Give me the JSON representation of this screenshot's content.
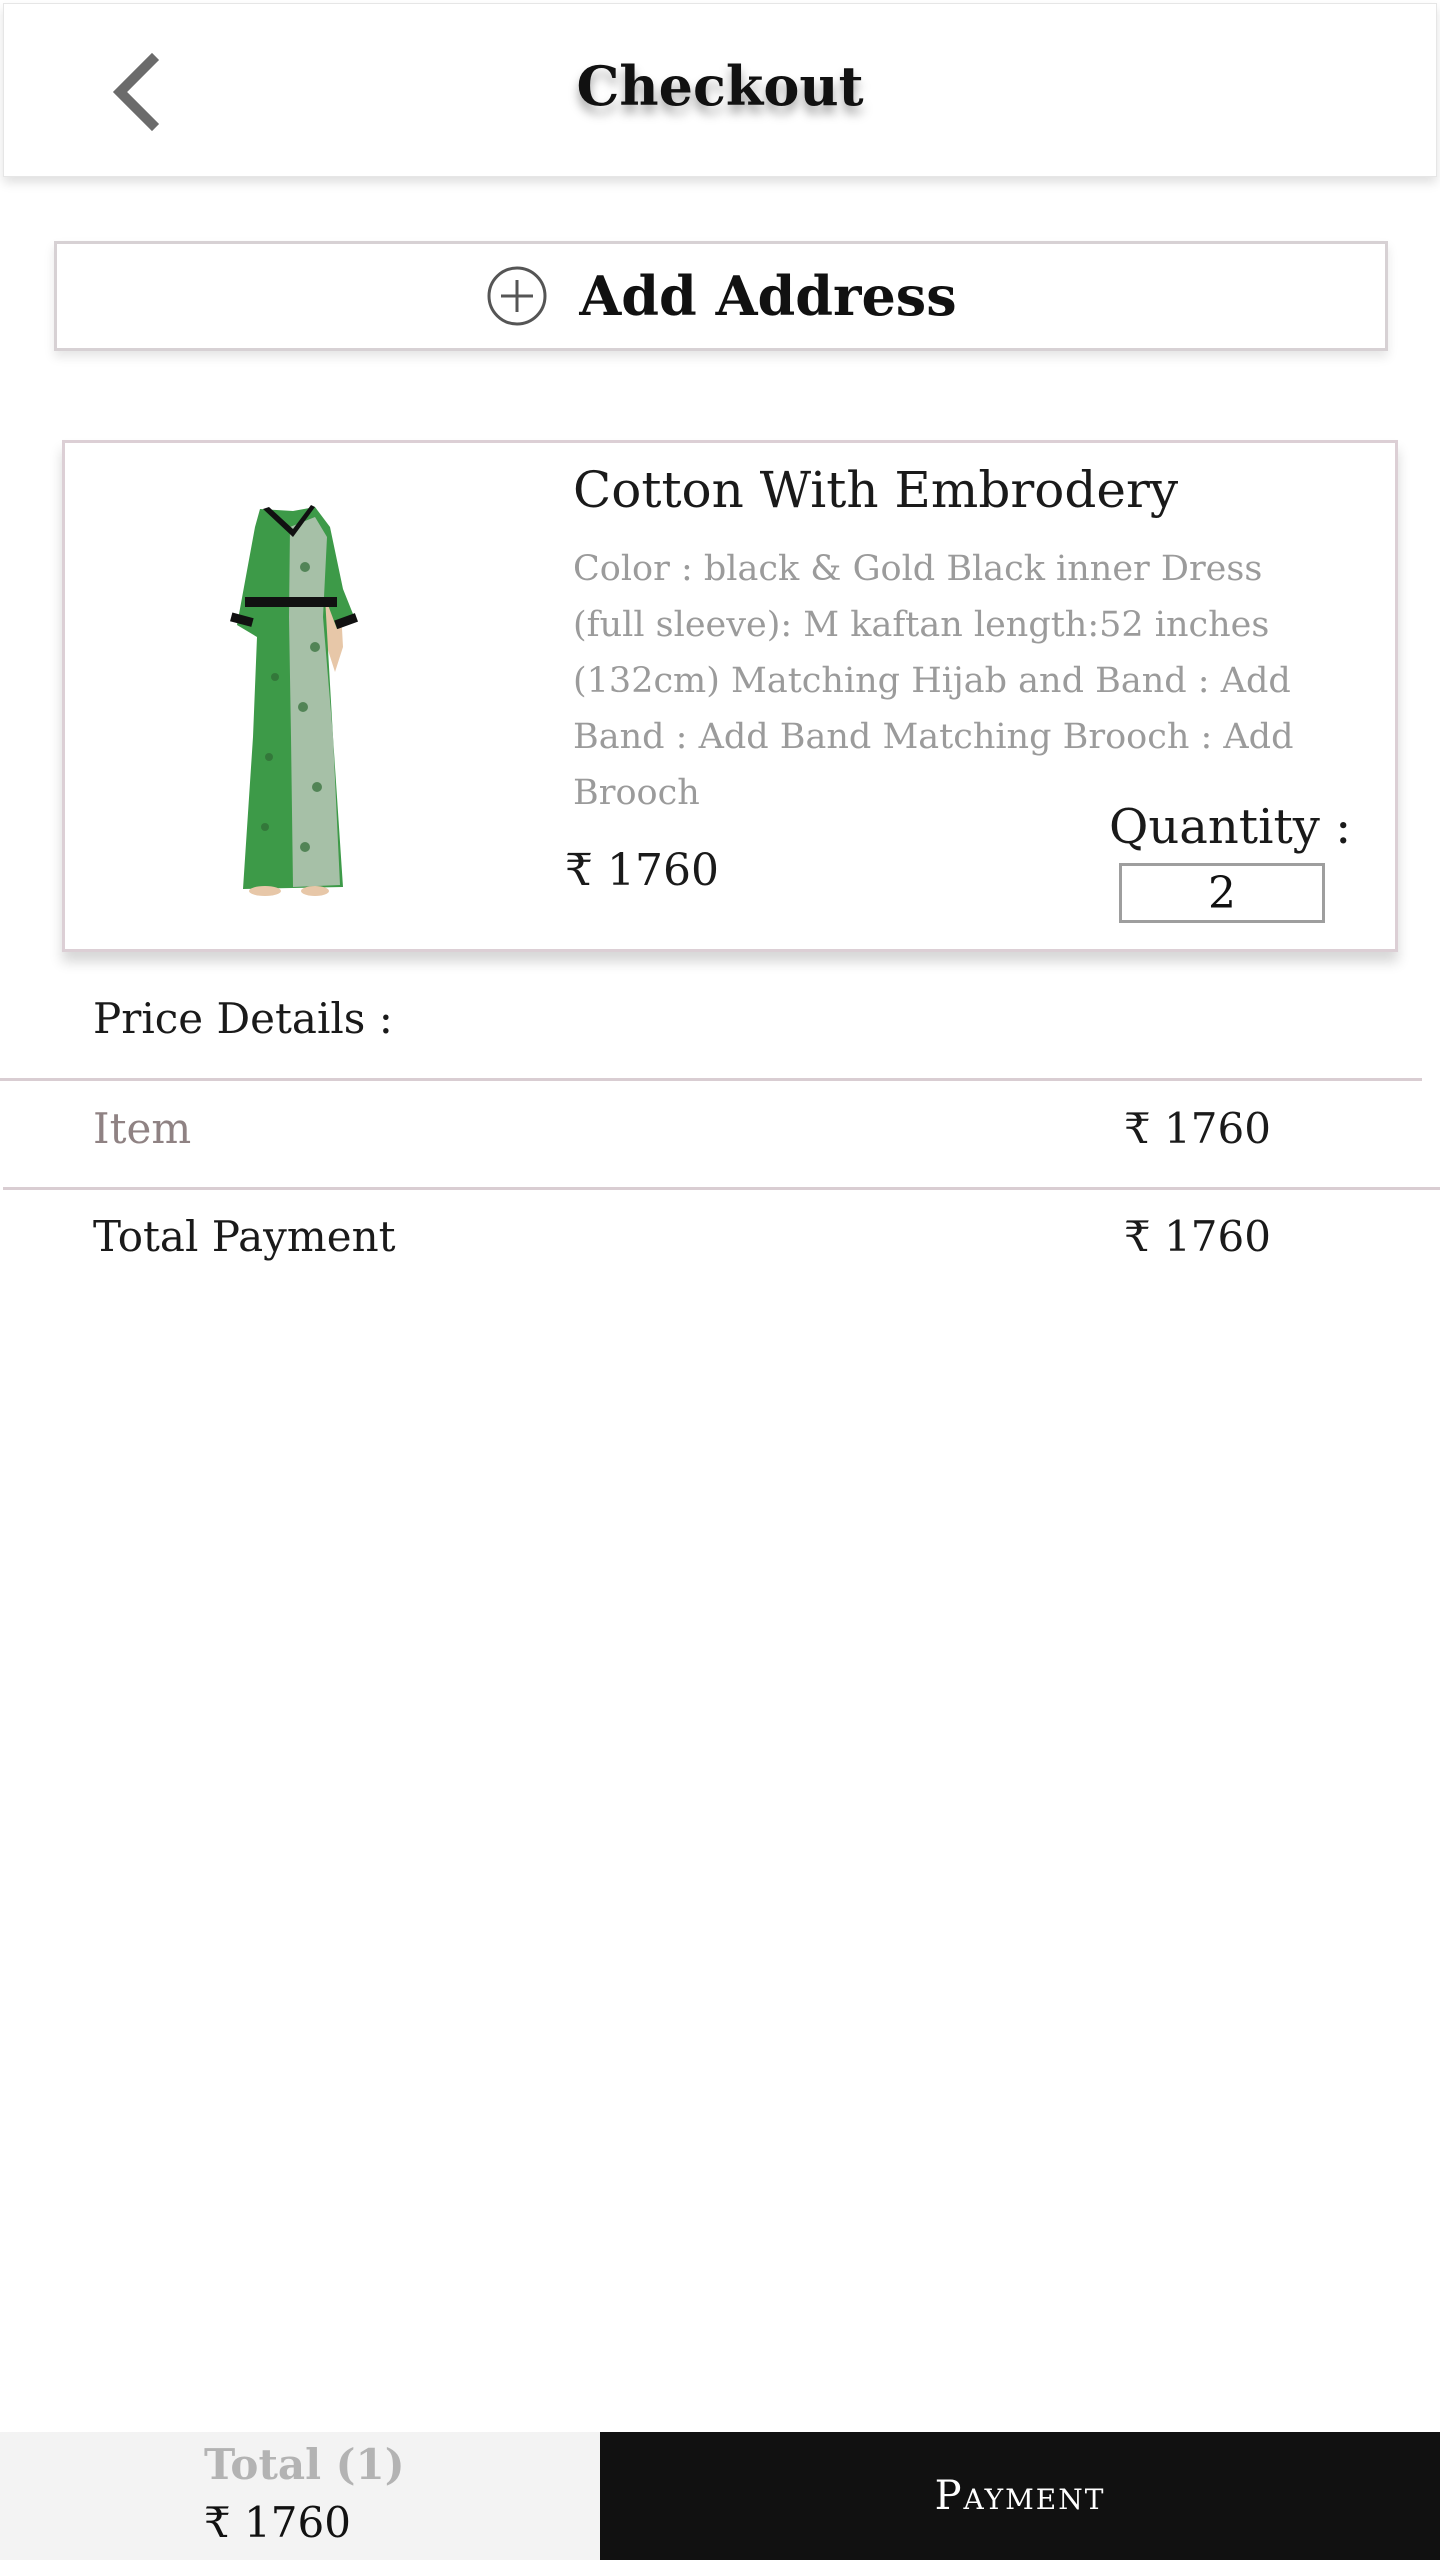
{
  "header": {
    "title": "Checkout",
    "back_icon": "chevron-left-icon"
  },
  "address": {
    "label": "Add Address",
    "icon": "plus-circle-icon"
  },
  "product": {
    "name": "Cotton With Embrodery",
    "description": "Color : black & Gold Black inner Dress (full sleeve): M kaftan length:52 inches (132cm) Matching  Hijab and Band : Add  Band : Add Band Matching Brooch : Add Brooch",
    "price": "₹ 1760",
    "quantity_label": "Quantity :",
    "quantity": "2",
    "image_colors": {
      "dress": "#3d9a48",
      "pattern": "#b9c7b8",
      "trim": "#111111"
    }
  },
  "price_details": {
    "title": "Price Details :",
    "item_label": "Item",
    "item_value": "₹ 1760",
    "total_label": "Total Payment",
    "total_value": "₹ 1760"
  },
  "footer": {
    "total_label": "Total (1)",
    "total_value": "₹ 1760",
    "payment_label": "Payment"
  },
  "colors": {
    "accent_dark": "#111111",
    "muted_text": "#9b9b9b",
    "item_label": "#8f8283",
    "divider": "#d9cdd2"
  }
}
